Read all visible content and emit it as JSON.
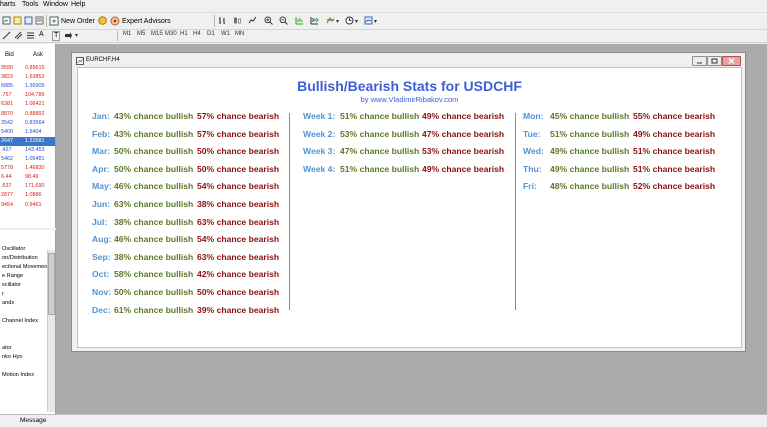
{
  "menu": [
    "harts",
    "Tools",
    "Window",
    "Help"
  ],
  "toolbar": {
    "new_order": "New Order",
    "expert_advisors": "Expert Advisors",
    "timeframes": [
      "M1",
      "M5",
      "M15",
      "M30",
      "H1",
      "H4",
      "D1",
      "W1",
      "MN"
    ],
    "drawing_glyphs": [
      "A",
      "T"
    ]
  },
  "market_watch": {
    "headers": {
      "bid": "Bid",
      "ask": "Ask"
    },
    "rows": [
      {
        "bid": "9590",
        "ask": "0.89615",
        "color": "#d42020"
      },
      {
        "bid": "3823",
        "ask": "1.63852",
        "color": "#d42020"
      },
      {
        "bid": "6885",
        "ask": "1.36905",
        "color": "#1f4ee0"
      },
      {
        "bid": ".767",
        "ask": "104.786",
        "color": "#d42020"
      },
      {
        "bid": "6381",
        "ask": "1.06421",
        "color": "#d42020"
      },
      {
        "bid": "8870",
        "ask": "0.88892",
        "color": "#d42020"
      },
      {
        "bid": "3542",
        "ask": "0.83564",
        "color": "#1f4ee0"
      },
      {
        "bid": "5400",
        "ask": "1.5404",
        "color": "#1f4ee0"
      },
      {
        "bid": "2647",
        "ask": "1.22681",
        "color": "#ffffff",
        "selected": true
      },
      {
        "bid": ".427",
        "ask": "143.453",
        "color": "#1f4ee0"
      },
      {
        "bid": "5462",
        "ask": "1.05481",
        "color": "#1f4ee0"
      },
      {
        "bid": "5778",
        "ask": "1.46830",
        "color": "#d42020"
      },
      {
        "bid": "6.44",
        "ask": "98.49",
        "color": "#d42020"
      },
      {
        "bid": ".637",
        "ask": "171.690",
        "color": "#d42020"
      },
      {
        "bid": "2877",
        "ask": "1.0886",
        "color": "#d42020"
      },
      {
        "bid": "9454",
        "ask": "0.9461",
        "color": "#d42020"
      }
    ]
  },
  "navigator": {
    "items": [
      "Oscillator",
      "on/Distribution",
      "ectional Movemen",
      "e Range",
      "scillator",
      "r",
      "ands",
      "",
      "Channel Index",
      "",
      "",
      "ator",
      "nko Hyo",
      "",
      "Motion Index"
    ]
  },
  "chart_window": {
    "title": "EURCHF,H4",
    "stats_title": "Bullish/Bearish Stats for USDCHF",
    "stats_subtitle": "by www.VladimirRibakov.com",
    "months": [
      {
        "label": "Jan:",
        "bullish": "43% chance bullish",
        "bearish": "57% chance bearish"
      },
      {
        "label": "Feb:",
        "bullish": "43% chance bullish",
        "bearish": "57% chance bearish"
      },
      {
        "label": "Mar:",
        "bullish": "50% chance bullish",
        "bearish": "50% chance bearish"
      },
      {
        "label": "Apr:",
        "bullish": "50% chance bullish",
        "bearish": "50% chance bearish"
      },
      {
        "label": "May:",
        "bullish": "46% chance bullish",
        "bearish": "54% chance bearish"
      },
      {
        "label": "Jun:",
        "bullish": "63% chance bullish",
        "bearish": "38% chance bearish"
      },
      {
        "label": "Jul:",
        "bullish": "38% chance bullish",
        "bearish": "63% chance bearish"
      },
      {
        "label": "Aug:",
        "bullish": "46% chance bullish",
        "bearish": "54% chance bearish"
      },
      {
        "label": "Sep:",
        "bullish": "38% chance bullish",
        "bearish": "63% chance bearish"
      },
      {
        "label": "Oct:",
        "bullish": "58% chance bullish",
        "bearish": "42% chance bearish"
      },
      {
        "label": "Nov:",
        "bullish": "50% chance bullish",
        "bearish": "50% chance bearish"
      },
      {
        "label": "Dec:",
        "bullish": "61% chance bullish",
        "bearish": "39% chance bearish"
      }
    ],
    "weeks": [
      {
        "label": "Week 1:",
        "bullish": "51% chance bullish",
        "bearish": "49% chance bearish"
      },
      {
        "label": "Week 2:",
        "bullish": "53% chance bullish",
        "bearish": "47% chance bearish"
      },
      {
        "label": "Week 3:",
        "bullish": "47% chance bullish",
        "bearish": "53% chance bearish"
      },
      {
        "label": "Week 4:",
        "bullish": "51% chance bullish",
        "bearish": "49% chance bearish"
      }
    ],
    "days": [
      {
        "label": "Mon:",
        "bullish": "45% chance bullish",
        "bearish": "55% chance bearish"
      },
      {
        "label": "Tue:",
        "bullish": "51% chance bullish",
        "bearish": "49% chance bearish"
      },
      {
        "label": "Wed:",
        "bullish": "49% chance bullish",
        "bearish": "51% chance bearish"
      },
      {
        "label": "Thu:",
        "bullish": "49% chance bullish",
        "bearish": "51% chance bearish"
      },
      {
        "label": "Fri:",
        "bullish": "48% chance bullish",
        "bearish": "52% chance bearish"
      }
    ],
    "colors": {
      "title": "#3e5fd2",
      "label": "#4f93d6",
      "bullish": "#5a7a28",
      "bearish": "#8b1111"
    }
  },
  "status": {
    "message": "Message"
  }
}
